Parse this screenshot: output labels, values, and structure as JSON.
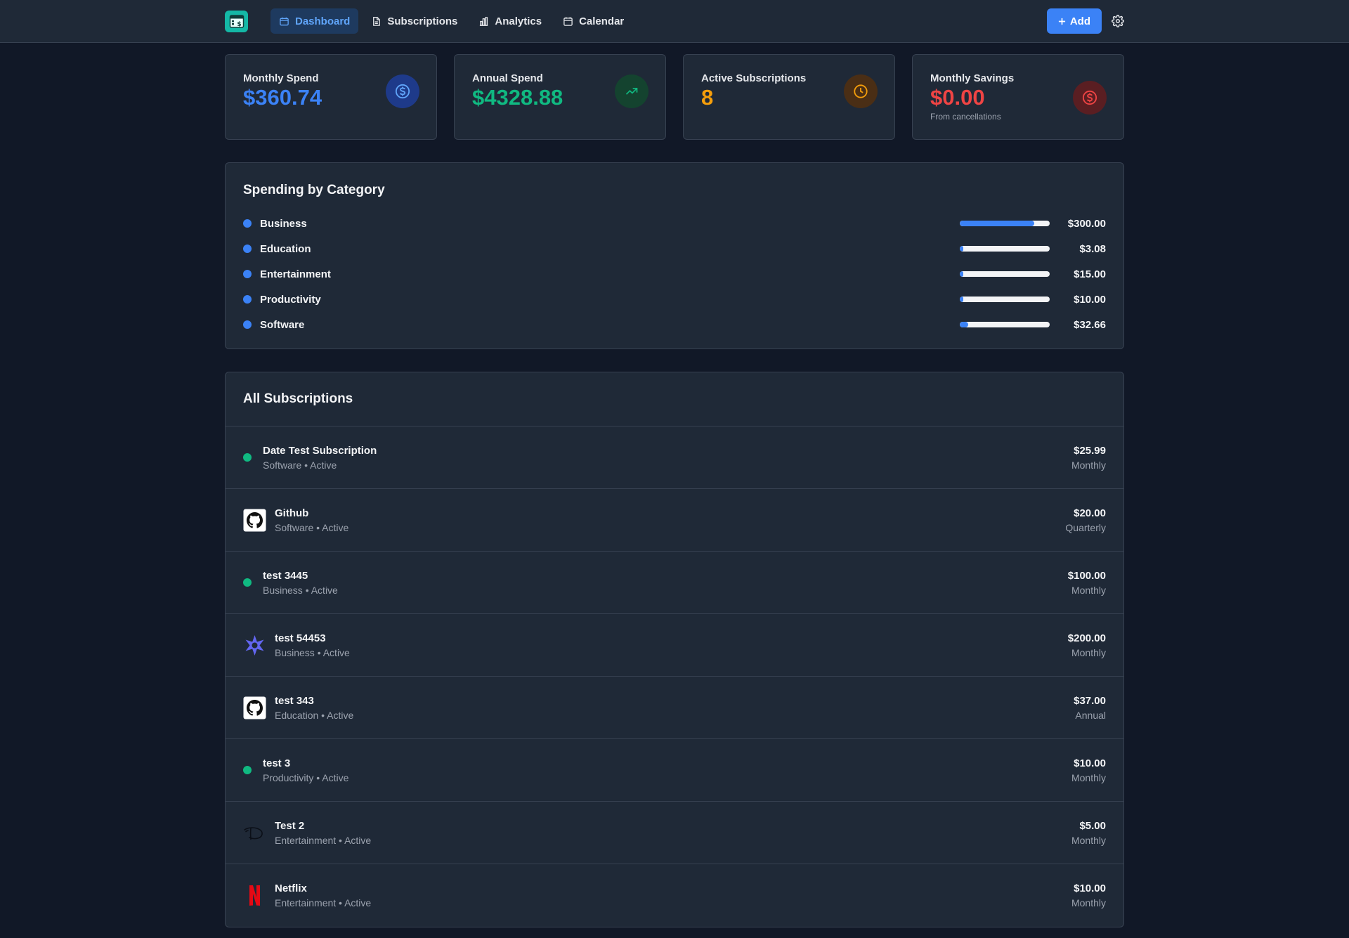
{
  "nav": {
    "items": [
      {
        "label": "Dashboard",
        "icon": "dashboard-icon",
        "active": true
      },
      {
        "label": "Subscriptions",
        "icon": "document-icon"
      },
      {
        "label": "Analytics",
        "icon": "bar-chart-icon"
      },
      {
        "label": "Calendar",
        "icon": "calendar-icon"
      }
    ],
    "add_label": "Add"
  },
  "stats": [
    {
      "label": "Monthly Spend",
      "value": "$360.74",
      "color": "#3b82f6",
      "icon": "dollar-icon"
    },
    {
      "label": "Annual Spend",
      "value": "$4328.88",
      "color": "#10b981",
      "icon": "trending-up-icon"
    },
    {
      "label": "Active Subscriptions",
      "value": "8",
      "color": "#f59e0b",
      "icon": "clock-icon"
    },
    {
      "label": "Monthly Savings",
      "value": "$0.00",
      "sub": "From cancellations",
      "color": "#ef4444",
      "icon": "dollar-icon"
    }
  ],
  "category": {
    "title": "Spending by Category",
    "items": [
      {
        "name": "Business",
        "amount": "$300.00",
        "share": 0.83
      },
      {
        "name": "Education",
        "amount": "$3.08",
        "share": 0.01
      },
      {
        "name": "Entertainment",
        "amount": "$15.00",
        "share": 0.04
      },
      {
        "name": "Productivity",
        "amount": "$10.00",
        "share": 0.03
      },
      {
        "name": "Software",
        "amount": "$32.66",
        "share": 0.09
      }
    ]
  },
  "subscriptions": {
    "title": "All Subscriptions",
    "items": [
      {
        "name": "Date Test Subscription",
        "meta": "Software • Active",
        "price": "$25.99",
        "freq": "Monthly",
        "logo": "status-dot"
      },
      {
        "name": "Github",
        "meta": "Software • Active",
        "price": "$20.00",
        "freq": "Quarterly",
        "logo": "github-icon"
      },
      {
        "name": "test 3445",
        "meta": "Business • Active",
        "price": "$100.00",
        "freq": "Monthly",
        "logo": "status-dot"
      },
      {
        "name": "test 54453",
        "meta": "Business • Active",
        "price": "$200.00",
        "freq": "Monthly",
        "logo": "star-logo-icon"
      },
      {
        "name": "test 343",
        "meta": "Education • Active",
        "price": "$37.00",
        "freq": "Annual",
        "logo": "github-icon"
      },
      {
        "name": "test 3",
        "meta": "Productivity • Active",
        "price": "$10.00",
        "freq": "Monthly",
        "logo": "status-dot"
      },
      {
        "name": "Test 2",
        "meta": "Entertainment • Active",
        "price": "$5.00",
        "freq": "Monthly",
        "logo": "disney-icon"
      },
      {
        "name": "Netflix",
        "meta": "Entertainment • Active",
        "price": "$10.00",
        "freq": "Monthly",
        "logo": "netflix-icon"
      }
    ]
  }
}
